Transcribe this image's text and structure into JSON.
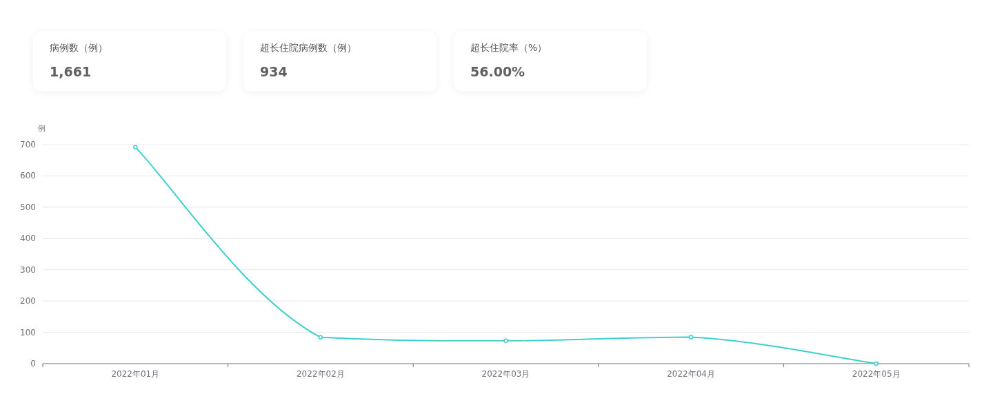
{
  "stats": [
    {
      "label": "病例数（例）",
      "value": "1,661"
    },
    {
      "label": "超长住院病例数（例）",
      "value": "934"
    },
    {
      "label": "超长住院率（%）",
      "value": "56.00%"
    }
  ],
  "chart": {
    "chart_data": {
      "type": "line",
      "ylabel": "例",
      "categories": [
        "2022年01月",
        "2022年02月",
        "2022年03月",
        "2022年04月",
        "2022年05月"
      ],
      "series": [
        {
          "color": "#3fcfcf",
          "marker": true,
          "values": [
            692,
            84,
            73,
            85,
            0
          ]
        }
      ],
      "grid": true,
      "ylim": [
        0,
        700
      ],
      "yticks": [
        0,
        100,
        200,
        300,
        400,
        500,
        600,
        700
      ]
    }
  }
}
